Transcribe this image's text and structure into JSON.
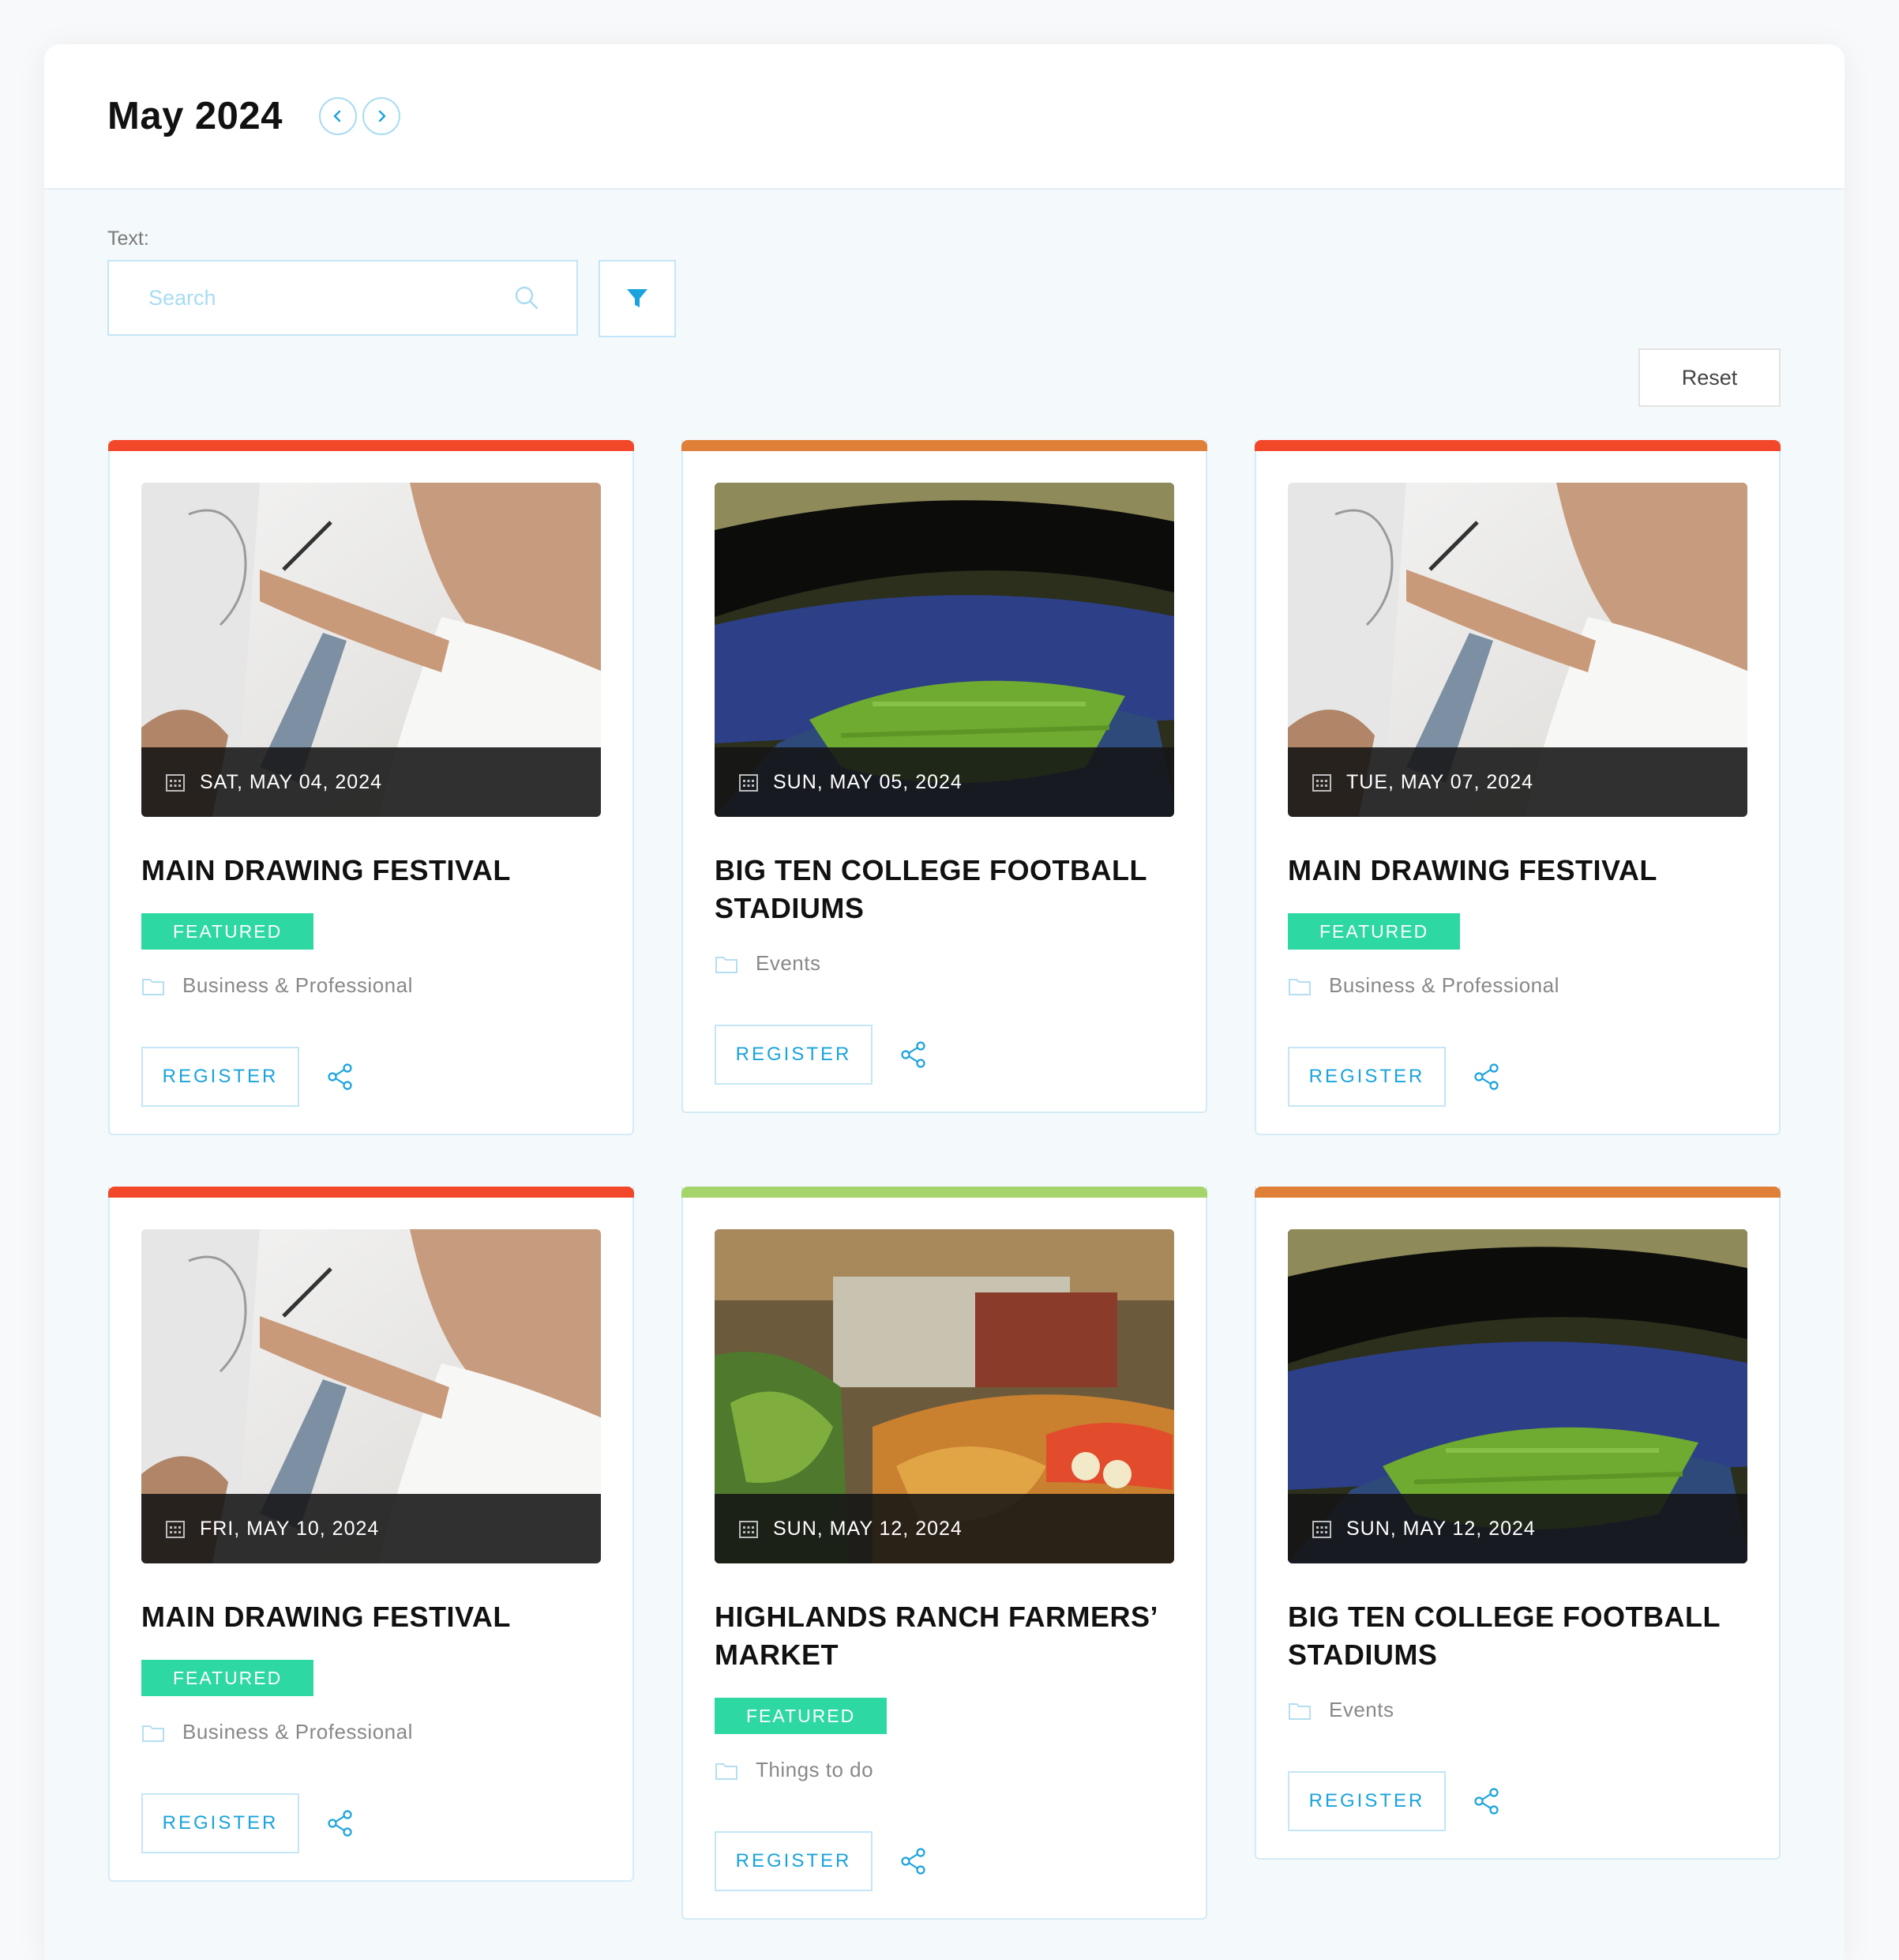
{
  "header": {
    "title": "May 2024"
  },
  "filters": {
    "text_label": "Text:",
    "search_placeholder": "Search",
    "reset_label": "Reset"
  },
  "colors": {
    "red": "#f3472a",
    "orange": "#e07f38",
    "green": "#a5d46b",
    "badge": "#2ed8a3",
    "accent": "#1aa3dd"
  },
  "events": [
    {
      "date": "SAT, MAY 04, 2024",
      "title": "MAIN DRAWING FESTIVAL",
      "badge": "FEATURED",
      "category": "Business & Professional",
      "register": "REGISTER"
    },
    {
      "date": "SUN, MAY 05, 2024",
      "title": "BIG TEN COLLEGE FOOTBALL STADIUMS",
      "category": "Events",
      "register": "REGISTER"
    },
    {
      "date": "TUE, MAY 07, 2024",
      "title": "MAIN DRAWING FESTIVAL",
      "badge": "FEATURED",
      "category": "Business & Professional",
      "register": "REGISTER"
    },
    {
      "date": "FRI, MAY 10, 2024",
      "title": "MAIN DRAWING FESTIVAL",
      "badge": "FEATURED",
      "category": "Business & Professional",
      "register": "REGISTER"
    },
    {
      "date": "SUN, MAY 12, 2024",
      "title": "HIGHLANDS RANCH FARMERS’ MARKET",
      "badge": "FEATURED",
      "category": "Things to do",
      "register": "REGISTER"
    },
    {
      "date": "SUN, MAY 12, 2024",
      "title": "BIG TEN COLLEGE FOOTBALL STADIUMS",
      "category": "Events",
      "register": "REGISTER"
    }
  ]
}
